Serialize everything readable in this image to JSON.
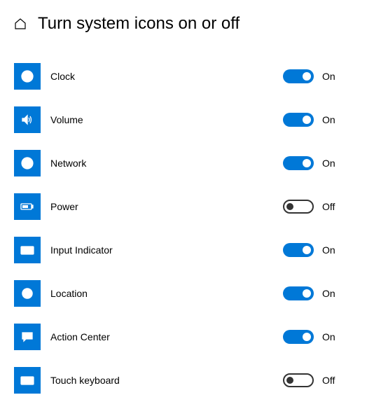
{
  "page": {
    "title": "Turn system icons on or off"
  },
  "labels": {
    "on": "On",
    "off": "Off"
  },
  "settings": [
    {
      "id": "clock",
      "label": "Clock",
      "state": "on",
      "icon": "clock"
    },
    {
      "id": "volume",
      "label": "Volume",
      "state": "on",
      "icon": "volume"
    },
    {
      "id": "network",
      "label": "Network",
      "state": "on",
      "icon": "network"
    },
    {
      "id": "power",
      "label": "Power",
      "state": "off",
      "icon": "power"
    },
    {
      "id": "input-indicator",
      "label": "Input Indicator",
      "state": "on",
      "icon": "keyboard"
    },
    {
      "id": "location",
      "label": "Location",
      "state": "on",
      "icon": "location"
    },
    {
      "id": "action-center",
      "label": "Action Center",
      "state": "on",
      "icon": "action-center"
    },
    {
      "id": "touch-keyboard",
      "label": "Touch keyboard",
      "state": "off",
      "icon": "touch-keyboard"
    }
  ]
}
